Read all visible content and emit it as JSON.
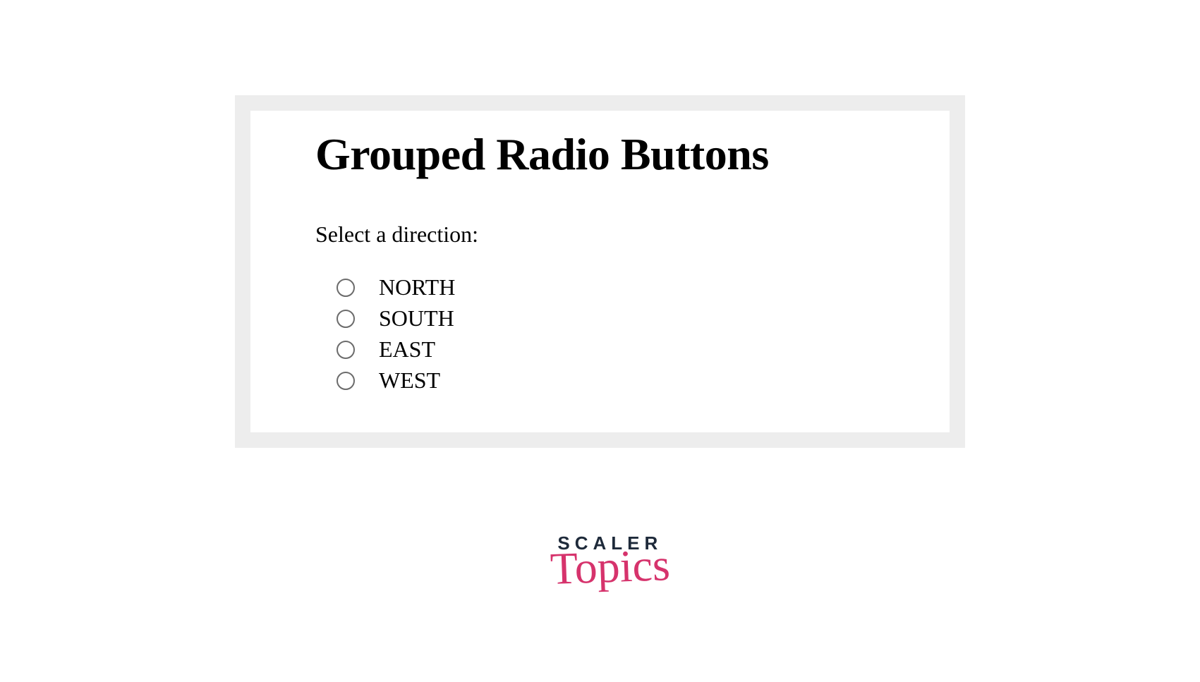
{
  "heading": "Grouped Radio Buttons",
  "prompt": "Select a direction:",
  "options": [
    {
      "label": "NORTH"
    },
    {
      "label": "SOUTH"
    },
    {
      "label": "EAST"
    },
    {
      "label": "WEST"
    }
  ],
  "logo": {
    "top": "SCALER",
    "bottom": "Topics"
  }
}
